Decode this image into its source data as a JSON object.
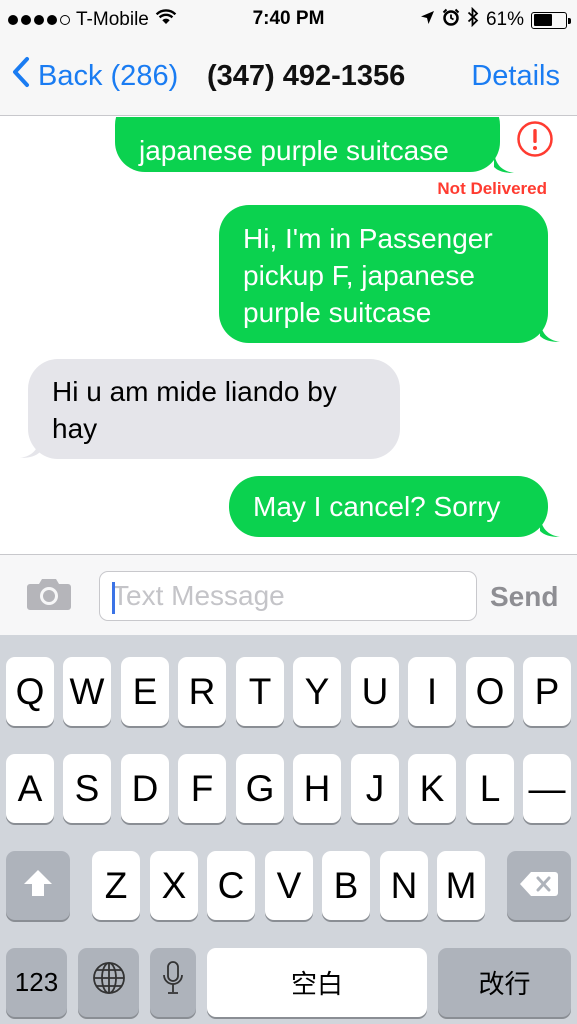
{
  "status_bar": {
    "carrier": "T-Mobile",
    "time": "7:40 PM",
    "battery": "61%",
    "battery_level": 0.61,
    "signal_bars_filled": 4,
    "signal_bars_total": 5
  },
  "nav": {
    "back_label": "Back (286)",
    "title": "(347) 492-1356",
    "details_label": "Details"
  },
  "messages": [
    {
      "direction": "outgoing",
      "text": "japanese purple suitcase",
      "status": "Not Delivered"
    },
    {
      "direction": "outgoing",
      "lines": [
        "Hi, I'm in Passenger",
        "pickup F, japanese",
        "purple suitcase"
      ]
    },
    {
      "direction": "incoming",
      "lines": [
        "Hi u am mide liando by",
        "hay"
      ]
    },
    {
      "direction": "outgoing",
      "text": "May I cancel? Sorry"
    }
  ],
  "input": {
    "placeholder": "Text Message",
    "value": "",
    "send_label": "Send"
  },
  "keyboard": {
    "row1": [
      "Q",
      "W",
      "E",
      "R",
      "T",
      "Y",
      "U",
      "I",
      "O",
      "P"
    ],
    "row2": [
      "A",
      "S",
      "D",
      "F",
      "G",
      "H",
      "J",
      "K",
      "L",
      "—"
    ],
    "row3": [
      "Z",
      "X",
      "C",
      "V",
      "B",
      "N",
      "M"
    ],
    "numbers_label": "123",
    "space_label": "空白",
    "return_label": "改行"
  },
  "colors": {
    "ios_blue": "#1a7cf2",
    "sms_green": "#0bd24f",
    "incoming_gray": "#e5e5ea",
    "error_red": "#ff3b30"
  }
}
